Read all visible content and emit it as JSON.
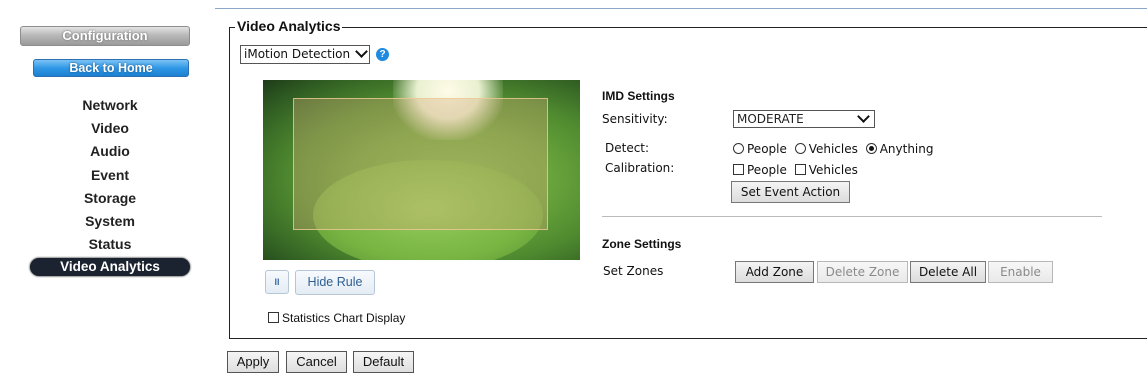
{
  "sidebar": {
    "config_label": "Configuration",
    "home_label": "Back to Home",
    "items": [
      {
        "label": "Network"
      },
      {
        "label": "Video"
      },
      {
        "label": "Audio"
      },
      {
        "label": "Event"
      },
      {
        "label": "Storage"
      },
      {
        "label": "System"
      },
      {
        "label": "Status"
      },
      {
        "label": "Video Analytics",
        "active": true
      }
    ]
  },
  "main": {
    "legend": "Video Analytics",
    "mode_select": {
      "value": "iMotion Detection"
    },
    "help_icon": "?",
    "pause_label": "II",
    "hide_rule_label": "Hide Rule",
    "stats_label": "Statistics Chart Display",
    "imd": {
      "title": "IMD Settings",
      "sensitivity_label": "Sensitivity:",
      "sensitivity_value": "MODERATE",
      "detect_label": "Detect:",
      "detect_options": [
        {
          "label": "People",
          "checked": false
        },
        {
          "label": "Vehicles",
          "checked": false
        },
        {
          "label": "Anything",
          "checked": true
        }
      ],
      "calibration_label": "Calibration:",
      "calibration_options": [
        {
          "label": "People",
          "checked": false
        },
        {
          "label": "Vehicles",
          "checked": false
        }
      ],
      "set_event_label": "Set Event Action"
    },
    "zone": {
      "title": "Zone Settings",
      "set_zones_label": "Set Zones",
      "add_label": "Add Zone",
      "delete_label": "Delete Zone",
      "delete_all_label": "Delete All",
      "enable_label": "Enable"
    }
  },
  "footer": {
    "apply_label": "Apply",
    "cancel_label": "Cancel",
    "default_label": "Default"
  }
}
